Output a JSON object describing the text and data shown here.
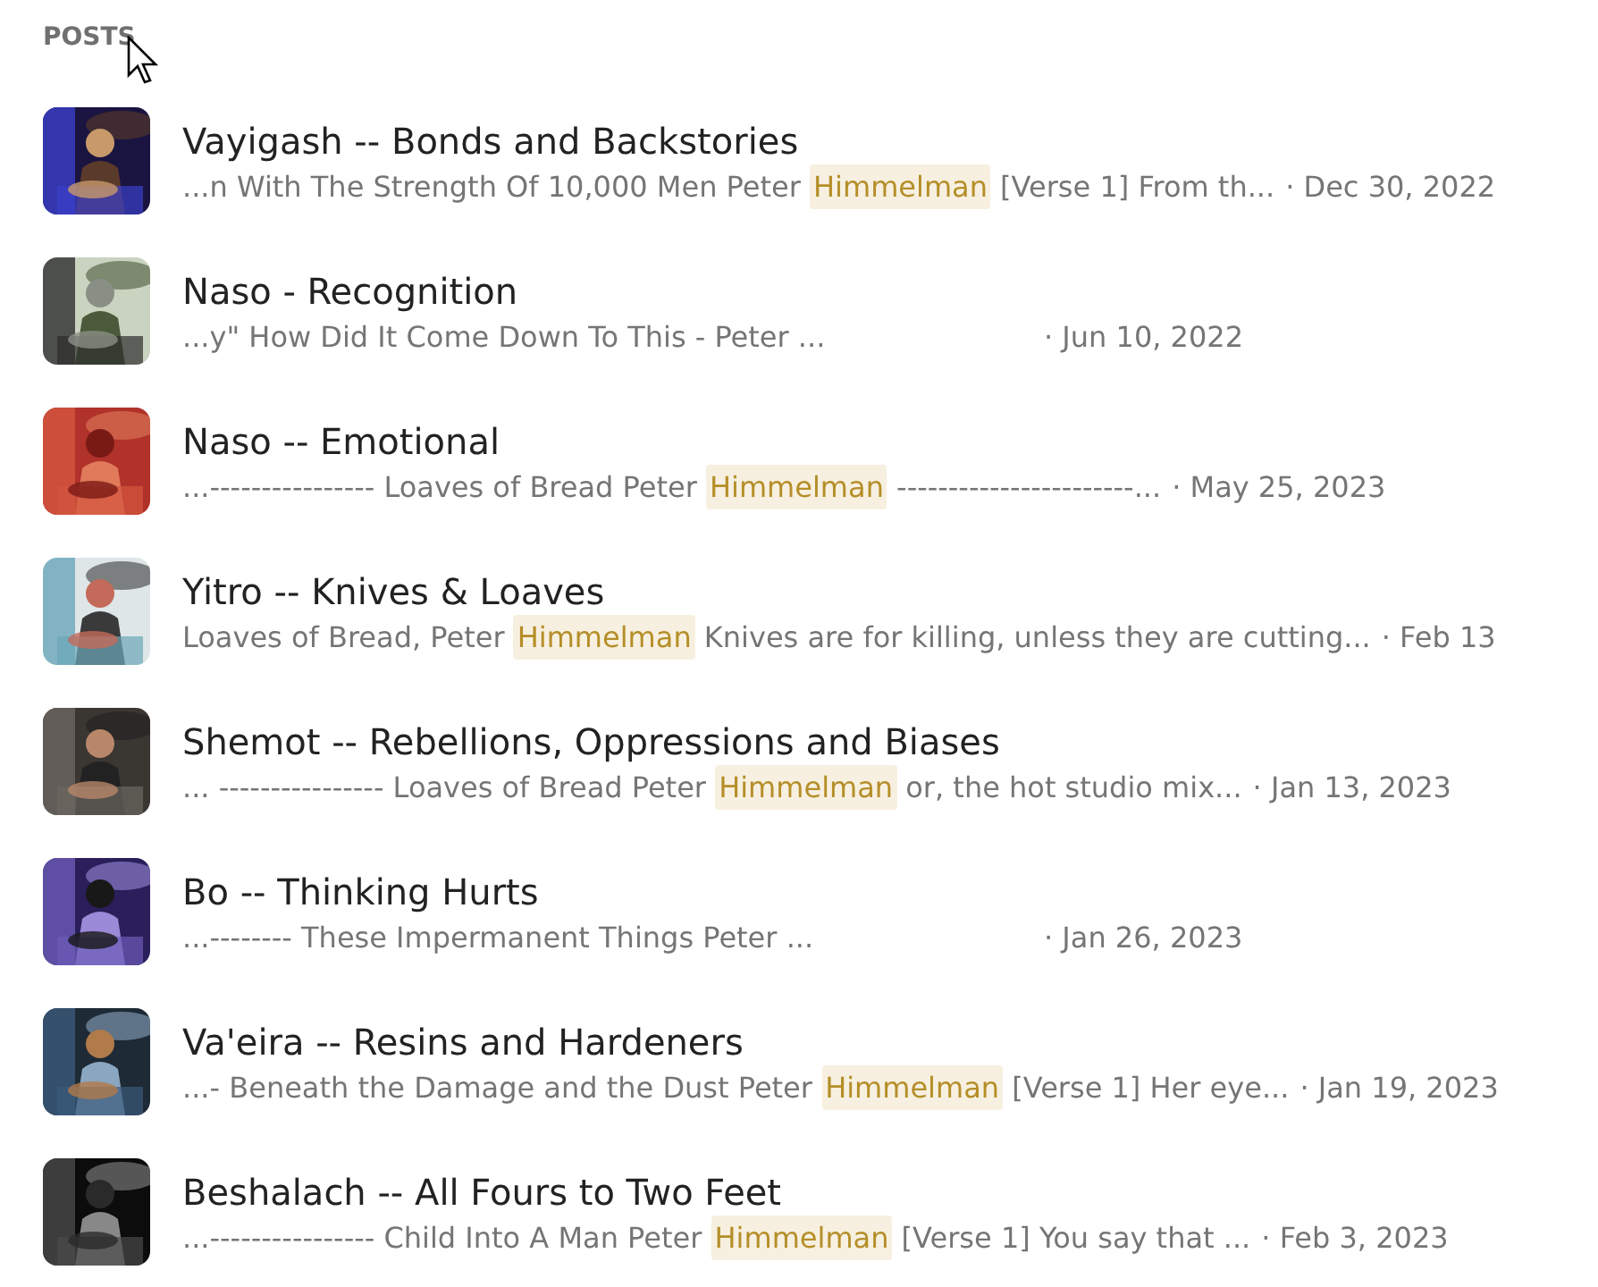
{
  "section": {
    "heading": "POSTS"
  },
  "posts": [
    {
      "title": "Vayigash -- Bonds and Backstories",
      "snippet": {
        "before": "...n With The Strength Of 10,000 Men Peter ",
        "highlight": "Himmelman",
        "after": " [Verse 1] From th..."
      },
      "date": "· Dec 30, 2022"
    },
    {
      "title": "Naso - Recognition",
      "snippet": {
        "before": "...y\" How Did It Come Down To This - Peter ..."
      },
      "date": "· Jun 10, 2022"
    },
    {
      "title": "Naso -- Emotional",
      "snippet": {
        "before": "...---------------- Loaves of Bread Peter ",
        "highlight": "Himmelman",
        "after": " -----------------------..."
      },
      "date": "· May 25, 2023"
    },
    {
      "title": "Yitro -- Knives & Loaves",
      "snippet": {
        "before": "Loaves of Bread, Peter ",
        "highlight": "Himmelman",
        "after": " Knives are for killing, unless they are cutting..."
      },
      "date": "· Feb 13"
    },
    {
      "title": "Shemot -- Rebellions, Oppressions and Biases",
      "snippet": {
        "before": "... ---------------- Loaves of Bread Peter ",
        "highlight": "Himmelman",
        "after": " or, the hot studio mix..."
      },
      "date": "· Jan 13, 2023"
    },
    {
      "title": "Bo -- Thinking Hurts",
      "snippet": {
        "before": "...-------- These Impermanent Things Peter ..."
      },
      "date": "· Jan 26, 2023"
    },
    {
      "title": "Va'eira -- Resins and Hardeners",
      "snippet": {
        "before": "...- Beneath the Damage and the Dust Peter ",
        "highlight": "Himmelman",
        "after": " [Verse 1] Her eye..."
      },
      "date": "· Jan 19, 2023"
    },
    {
      "title": "Beshalach -- All Fours to Two Feet",
      "snippet": {
        "before": "...---------------- Child Into A Man Peter ",
        "highlight": "Himmelman",
        "after": " [Verse 1] You say that ..."
      },
      "date": "· Feb 3, 2023"
    }
  ]
}
